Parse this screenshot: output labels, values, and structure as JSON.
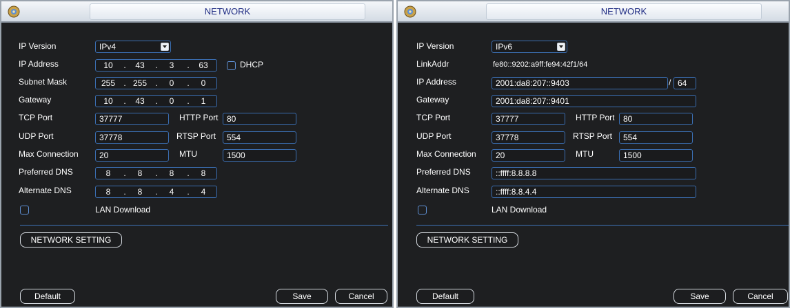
{
  "panels": [
    {
      "title": "NETWORK",
      "ip_version_label": "IP Version",
      "ip_version_value": "IPv4",
      "ip_address_label": "IP Address",
      "ip_address": [
        "10",
        "43",
        "3",
        "63"
      ],
      "dhcp_label": "DHCP",
      "subnet_mask_label": "Subnet Mask",
      "subnet_mask": [
        "255",
        "255",
        "0",
        "0"
      ],
      "gateway_label": "Gateway",
      "gateway": [
        "10",
        "43",
        "0",
        "1"
      ],
      "tcp_port_label": "TCP Port",
      "tcp_port": "37777",
      "http_port_label": "HTTP Port",
      "http_port": "80",
      "udp_port_label": "UDP Port",
      "udp_port": "37778",
      "rtsp_port_label": "RTSP Port",
      "rtsp_port": "554",
      "max_connection_label": "Max Connection",
      "max_connection": "20",
      "mtu_label": "MTU",
      "mtu": "1500",
      "preferred_dns_label": "Preferred DNS",
      "preferred_dns": [
        "8",
        "8",
        "8",
        "8"
      ],
      "alternate_dns_label": "Alternate DNS",
      "alternate_dns": [
        "8",
        "8",
        "4",
        "4"
      ],
      "lan_download_label": "LAN Download",
      "network_setting_label": "NETWORK SETTING",
      "default_label": "Default",
      "save_label": "Save",
      "cancel_label": "Cancel"
    },
    {
      "title": "NETWORK",
      "ip_version_label": "IP Version",
      "ip_version_value": "IPv6",
      "linkaddr_label": "LinkAddr",
      "linkaddr_value": "fe80::9202:a9ff:fe94:42f1/64",
      "ip_address_label": "IP Address",
      "ip_address": "2001:da8:207::9403",
      "prefix_separator": "/",
      "prefix_length": "64",
      "gateway_label": "Gateway",
      "gateway": "2001:da8:207::9401",
      "tcp_port_label": "TCP Port",
      "tcp_port": "37777",
      "http_port_label": "HTTP Port",
      "http_port": "80",
      "udp_port_label": "UDP Port",
      "udp_port": "37778",
      "rtsp_port_label": "RTSP Port",
      "rtsp_port": "554",
      "max_connection_label": "Max Connection",
      "max_connection": "20",
      "mtu_label": "MTU",
      "mtu": "1500",
      "preferred_dns_label": "Preferred DNS",
      "preferred_dns": "::ffff:8.8.8.8",
      "alternate_dns_label": "Alternate DNS",
      "alternate_dns": "::ffff:8.8.4.4",
      "lan_download_label": "LAN Download",
      "network_setting_label": "NETWORK SETTING",
      "default_label": "Default",
      "save_label": "Save",
      "cancel_label": "Cancel"
    }
  ],
  "colors": {
    "panel_bg": "#1e1f21",
    "field_border": "#3b6fb3",
    "title_text": "#1f2c83",
    "divider": "#3f76bf"
  }
}
